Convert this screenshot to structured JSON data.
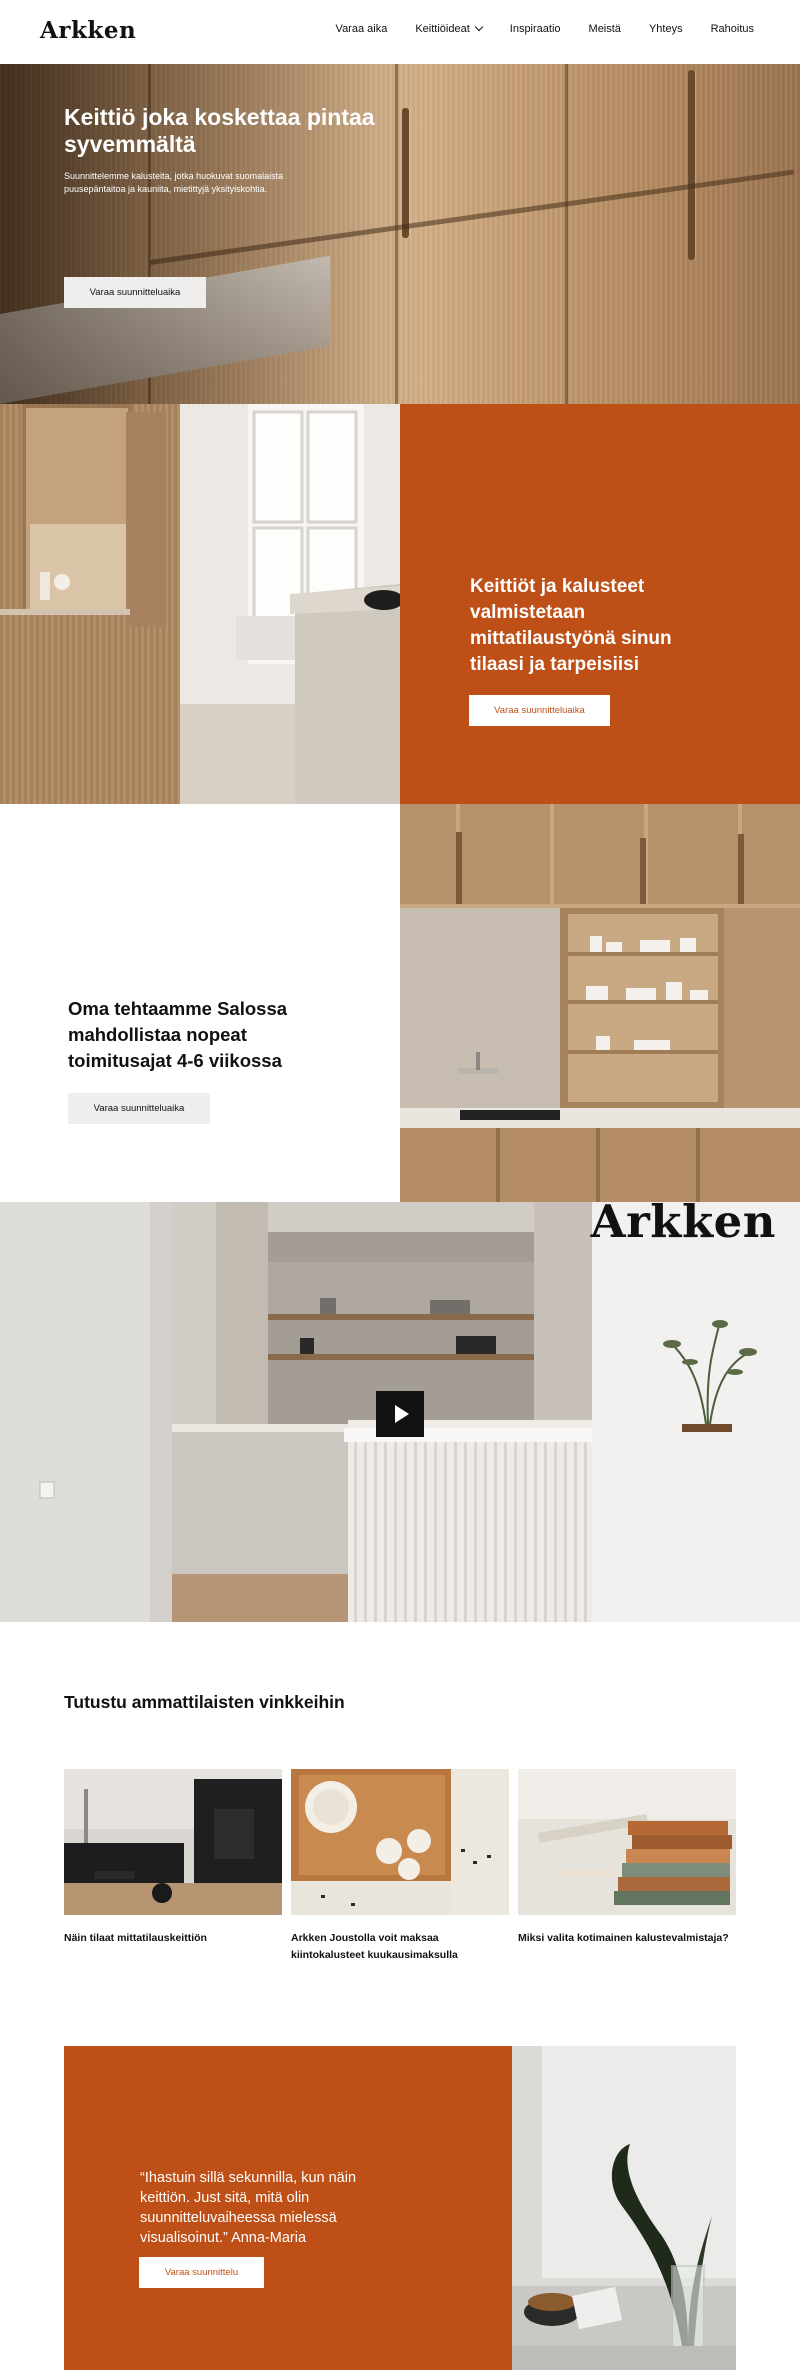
{
  "brand": {
    "logo": "Arkken"
  },
  "nav": {
    "items": [
      {
        "label": "Varaa aika"
      },
      {
        "label": "Keittiöideat",
        "has_dropdown": true
      },
      {
        "label": "Inspiraatio"
      },
      {
        "label": "Meistä"
      },
      {
        "label": "Yhteys"
      },
      {
        "label": "Rahoitus"
      }
    ]
  },
  "hero": {
    "title": "Keittiö joka koskettaa pintaa syvemmältä",
    "text": "Suunnittelemme kalusteita, jotka huokuvat suomalaista puusepäntaitoa ja kauniita, mietittyjä yksityiskohtia.",
    "button": "Varaa suunnitteluaika"
  },
  "section2": {
    "title": "Keittiöt ja kalusteet valmistetaan mittatilaustyönä sinun tilaasi ja tarpeisiisi",
    "button": "Varaa suunnitteluaika"
  },
  "section3": {
    "title": "Oma tehtaamme Salossa mahdollistaa nopeat toimitusajat 4-6 viikossa",
    "button": "Varaa suunnitteluaika"
  },
  "video": {
    "watermark": "Arkken",
    "play_icon": "play-icon"
  },
  "tips": {
    "title": "Tutustu ammattilaisten vinkkeihin",
    "cards": [
      {
        "label": "Näin tilaat mittatilauskeittiön"
      },
      {
        "label": "Arkken Joustolla voit maksaa kiintokalusteet kuukausimaksulla"
      },
      {
        "label": "Miksi valita kotimainen kalustevalmistaja?"
      }
    ]
  },
  "testimonial": {
    "quote": "“Ihastuin sillä sekunnilla, kun näin keittiön. Just sitä, mitä olin suunnitteluvaiheessa mielessä visualisoinut.” Anna-Maria",
    "button": "Varaa suunnittelu"
  },
  "colors": {
    "accent": "#bd4f17",
    "button_light": "#f0eeec",
    "text": "#111111"
  }
}
